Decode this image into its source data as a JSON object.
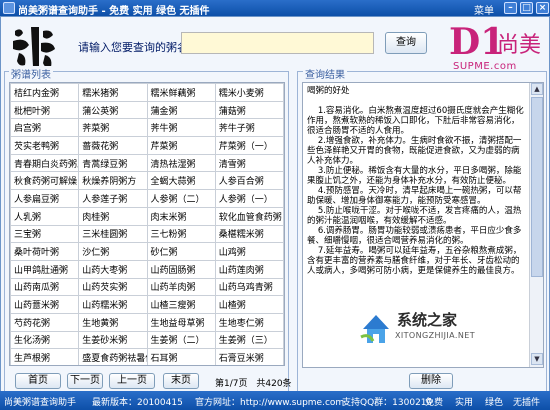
{
  "window": {
    "title": "尚美粥谱查询助手 - 免费 实用 绿色 无插件",
    "menu_label": "菜单"
  },
  "header": {
    "logo_text": "粥",
    "prompt_label": "请输入您要查询的粥名:",
    "search_value": "",
    "query_button": "查询",
    "brand_mark": "D1",
    "brand_name": "尚美",
    "brand_url": "SUPME.com"
  },
  "left_panel": {
    "title": "粥谱列表",
    "rows": [
      [
        "桔红内金粥",
        "糯米猪粥",
        "糯米鲜藕粥",
        "糯米小麦粥"
      ],
      [
        "枇杷叶粥",
        "蒲公英粥",
        "蒲金粥",
        "蒲菇粥"
      ],
      [
        "启宫粥",
        "荠菜粥",
        "荠牛粥",
        "荠牛子粥"
      ],
      [
        "芡实老鸭粥",
        "蔷薇花粥",
        "芹菜粥",
        "芹菜粥（一）"
      ],
      [
        "青春期白炎药粥三",
        "青蒿绿豆粥",
        "清热祛湿粥",
        "清雪粥"
      ],
      [
        "秋食药粥可解燥",
        "秋燥养阴粥方",
        "全蝎大蒜粥",
        "人参百合粥"
      ],
      [
        "人参扁豆粥",
        "人参莲子粥",
        "人参粥（二）",
        "人参粥（一）"
      ],
      [
        "人乳粥",
        "肉桂粥",
        "肉末米粥",
        "软化血管食药粥"
      ],
      [
        "三宝粥",
        "三米桂圆粥",
        "三七粉粥",
        "桑椹糯米粥"
      ],
      [
        "桑叶荷叶粥",
        "沙仁粥",
        "砂仁粥",
        "山鸡粥"
      ],
      [
        "山甲鸽肚通粥",
        "山药大枣粥",
        "山药固肠粥",
        "山药莲肉粥"
      ],
      [
        "山药南瓜粥",
        "山药芡实粥",
        "山药羊肉粥",
        "山药乌鸡青粥"
      ],
      [
        "山药薏米粥",
        "山药糯米粥",
        "山楂三瘦粥",
        "山楂粥"
      ],
      [
        "芍药花粥",
        "生地黄粥",
        "生地益母草粥",
        "生地枣仁粥"
      ],
      [
        "生化汤粥",
        "生姜砂米粥",
        "生姜粥（二）",
        "生姜粥（三）"
      ],
      [
        "生芦根粥",
        "盛夏食药粥祛暑保",
        "石耳粥",
        "石膏豆米粥"
      ],
      [
        "石膏绿豆粥",
        "石膏薏米粥",
        "石膏竹叶粥",
        "石决明粥"
      ]
    ],
    "first_button": "首页",
    "next_button": "下一页",
    "prev_button": "上一页",
    "last_button": "末页",
    "page_text": "第1/7页",
    "total_text": "共420条"
  },
  "right_panel": {
    "title": "查询结果",
    "result_text": "喝粥的好处\n\n    1.容易消化。白米熬煮温度超过60摄氏度就会产生糊化作用，熬煮软熟的稀饭入口即化，下肚后非常容易消化，很适合肠胃不适的人食用。\n    2.增强食欲，补充体力。生病时食欲不振，清粥搭配一些色泽鲜艳又开胃的食物，既能促进食欲，又为虚弱的病人补充体力。\n    3.防止便秘。稀饭含有大量的水分，平日多喝粥，除能果腹止饥之外，还能为身体补充水分，有效防止便秘。\n    4.预防感冒。天冷时，清早起床喝上一碗热粥，可以帮助保暖、增加身体御寒能力，能预防受寒感冒。\n    5.防止喉咙干涩。对于喉咙不适，发言疼痛的人，温热的粥汁能温润咽喉，有效缓解不适感。\n    6.调养肠胃。肠胃功能较弱或溃疡患者，平日应少食多餐、细嚼慢咽，很适合喝营养易消化的粥。\n    7.延年益寿。喝粥可以延年益寿，五谷杂粮熬煮成粥，含有更丰富的营养素与膳食纤维，对于年长、牙齿松动的人或病人，多喝粥可防小病，更是保健养生的最佳良方。",
    "delete_button": "删除",
    "watermark_main": "系统之家",
    "watermark_url": "XITONGZHIJIA.NET"
  },
  "statusbar": {
    "app_name": "尚美粥谱查询助手",
    "version": "最新版本：20100415",
    "website": "官方网址：http://www.supme.com",
    "support": "支持QQ群：1300210",
    "tag1": "免费",
    "tag2": "实用",
    "tag3": "绿色",
    "tag4": "无插件"
  }
}
